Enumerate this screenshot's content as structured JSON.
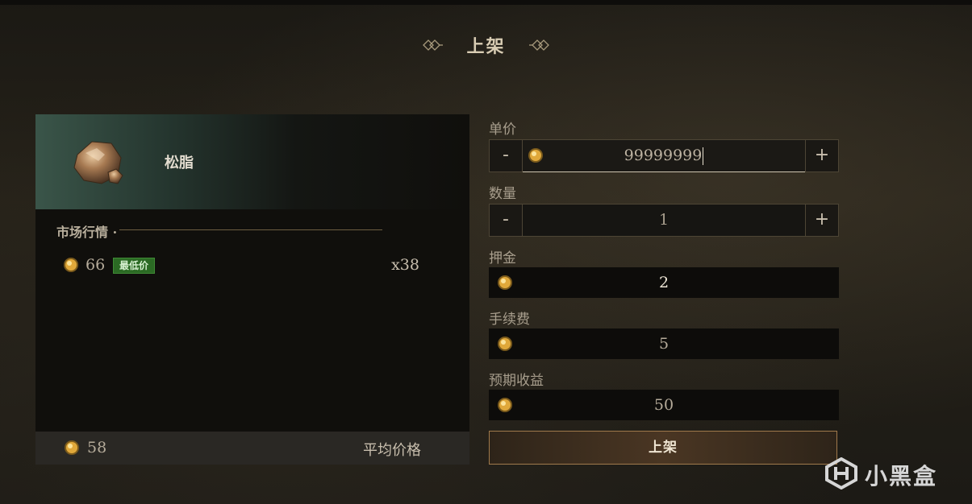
{
  "header": {
    "title": "上架"
  },
  "item": {
    "name": "松脂"
  },
  "market": {
    "title": "市场行情 ·",
    "rows": [
      {
        "price": "66",
        "badge": "最低价",
        "count": "x38"
      }
    ],
    "average": {
      "value": "58",
      "label": "平均价格"
    }
  },
  "form": {
    "unit_price": {
      "label": "单价",
      "value": "99999999",
      "minus": "-",
      "plus": "+"
    },
    "quantity": {
      "label": "数量",
      "value": "1",
      "minus": "-",
      "plus": "+"
    },
    "deposit": {
      "label": "押金",
      "value": "2"
    },
    "fee": {
      "label": "手续费",
      "value": "5"
    },
    "expected": {
      "label": "预期收益",
      "value": "50"
    },
    "submit_label": "上架"
  },
  "watermark": {
    "text": "小黑盒"
  },
  "colors": {
    "gold": "#e0a83a",
    "badge_green": "#2b6a24",
    "accent_border": "#a07a4c"
  },
  "icons": {
    "coin": "gold-coin-icon",
    "ornament": "diamond-ornament-icon",
    "item": "resin-item-icon"
  }
}
